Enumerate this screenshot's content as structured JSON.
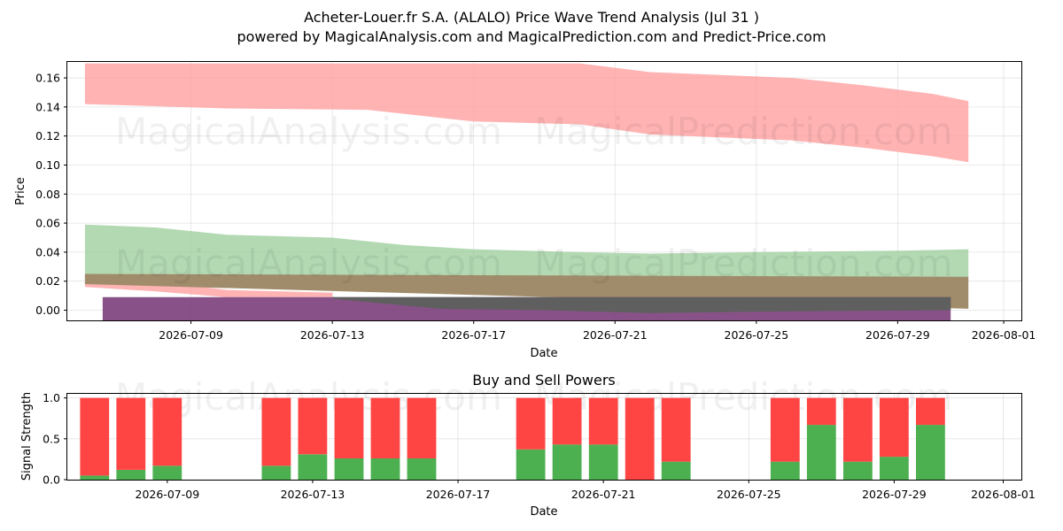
{
  "title": "Acheter-Louer.fr S.A. (ALALO) Price Wave Trend Analysis (Jul 31 )",
  "subtitle": "powered by MagicalAnalysis.com and MagicalPrediction.com and Predict-Price.com",
  "watermarks": [
    "MagicalAnalysis.com",
    "MagicalPrediction.com"
  ],
  "colors": {
    "red_band": "#ff9999",
    "green_band": "#99cc99",
    "brown_band": "#a08c6a",
    "purple_band": "#7b3f7b",
    "buy": "#4caf50",
    "sell": "#ff4444"
  },
  "chart_data": [
    {
      "type": "area",
      "xlabel": "Date",
      "ylabel": "Price",
      "xlim": [
        "2026-07-05T12:00",
        "2026-08-01T12:00"
      ],
      "ylim": [
        -0.007,
        0.171
      ],
      "grid": true,
      "x_ticks": [
        "2026-07-09",
        "2026-07-13",
        "2026-07-17",
        "2026-07-21",
        "2026-07-25",
        "2026-07-29",
        "2026-08-01"
      ],
      "y_ticks": [
        "0.00",
        "0.02",
        "0.04",
        "0.06",
        "0.08",
        "0.10",
        "0.12",
        "0.14",
        "0.16"
      ],
      "series": [
        {
          "key": "red_upper",
          "color": "red_band",
          "opacity": 0.75,
          "x": [
            "2026-07-06",
            "2026-07-10",
            "2026-07-14",
            "2026-07-17",
            "2026-07-20",
            "2026-07-22",
            "2026-07-26",
            "2026-07-28",
            "2026-07-30",
            "2026-07-31"
          ],
          "upper": [
            0.17,
            0.17,
            0.17,
            0.17,
            0.17,
            0.164,
            0.16,
            0.155,
            0.149,
            0.144
          ],
          "lower": [
            0.142,
            0.139,
            0.138,
            0.13,
            0.128,
            0.121,
            0.117,
            0.112,
            0.106,
            0.102
          ]
        },
        {
          "key": "red_lower",
          "color": "red_band",
          "opacity": 0.75,
          "x": [
            "2026-07-06",
            "2026-07-08",
            "2026-07-10",
            "2026-07-13"
          ],
          "upper": [
            0.022,
            0.02,
            0.014,
            0.012
          ],
          "lower": [
            0.016,
            0.013,
            0.009,
            0.009
          ]
        },
        {
          "key": "green",
          "color": "green_band",
          "opacity": 0.75,
          "x": [
            "2026-07-06",
            "2026-07-08",
            "2026-07-10",
            "2026-07-13",
            "2026-07-15",
            "2026-07-17",
            "2026-07-20",
            "2026-07-22",
            "2026-07-25",
            "2026-07-29",
            "2026-07-31"
          ],
          "upper": [
            0.059,
            0.057,
            0.052,
            0.05,
            0.045,
            0.042,
            0.04,
            0.039,
            0.04,
            0.041,
            0.042
          ],
          "lower": [
            0.022,
            0.022,
            0.022,
            0.022,
            0.022,
            0.022,
            0.022,
            0.022,
            0.022,
            0.022,
            0.022
          ]
        },
        {
          "key": "brown",
          "color": "brown_band",
          "opacity": 1,
          "x": [
            "2026-07-06",
            "2026-07-31"
          ],
          "upper": [
            0.025,
            0.023
          ],
          "lower": [
            0.018,
            0.001
          ]
        },
        {
          "key": "purple",
          "color": "purple_band",
          "opacity": 0.9,
          "x": [
            "2026-07-06T12:00",
            "2026-07-10",
            "2026-07-13",
            "2026-07-16",
            "2026-07-19",
            "2026-07-22",
            "2026-07-25",
            "2026-07-28",
            "2026-07-30T12:00"
          ],
          "upper": [
            0.009,
            0.009,
            0.009,
            0.009,
            0.009,
            0.009,
            0.009,
            0.009,
            0.009
          ],
          "lower": [
            -0.007,
            -0.007,
            -0.007,
            -0.007,
            -0.007,
            -0.007,
            -0.007,
            -0.007,
            -0.007
          ]
        },
        {
          "key": "dark",
          "color": "#5f5f5f",
          "opacity": 1,
          "x": [
            "2026-07-13",
            "2026-07-16",
            "2026-07-19",
            "2026-07-22",
            "2026-07-25",
            "2026-07-30T12:00"
          ],
          "upper": [
            0.009,
            0.009,
            0.009,
            0.009,
            0.009,
            0.009
          ],
          "lower": [
            0.008,
            0.001,
            0.0,
            -0.002,
            -0.001,
            0.0
          ]
        }
      ]
    },
    {
      "type": "bar",
      "title": "Buy and Sell Powers",
      "xlabel": "Date",
      "ylabel": "Signal Strength",
      "xlim": [
        "2026-07-06T06:00",
        "2026-08-01T12:00"
      ],
      "ylim": [
        0,
        1.05
      ],
      "grid": true,
      "x_ticks": [
        "2026-07-09",
        "2026-07-13",
        "2026-07-17",
        "2026-07-21",
        "2026-07-25",
        "2026-07-29",
        "2026-08-01"
      ],
      "y_ticks": [
        "0.0",
        "0.5",
        "1.0"
      ],
      "dates": [
        "2026-07-07",
        "2026-07-08",
        "2026-07-09",
        "2026-07-12",
        "2026-07-13",
        "2026-07-14",
        "2026-07-15",
        "2026-07-16",
        "2026-07-19",
        "2026-07-20",
        "2026-07-21",
        "2026-07-22",
        "2026-07-23",
        "2026-07-26",
        "2026-07-27",
        "2026-07-28",
        "2026-07-29",
        "2026-07-30"
      ],
      "series": [
        {
          "name": "Buy",
          "color": "buy",
          "values": [
            0.05,
            0.12,
            0.17,
            0.17,
            0.31,
            0.26,
            0.26,
            0.26,
            0.37,
            0.43,
            0.43,
            0.0,
            0.22,
            0.22,
            0.67,
            0.22,
            0.28,
            0.67
          ]
        },
        {
          "name": "Sell",
          "color": "sell",
          "values": [
            0.95,
            0.88,
            0.83,
            0.83,
            0.69,
            0.74,
            0.74,
            0.74,
            0.63,
            0.57,
            0.57,
            1.0,
            0.78,
            0.78,
            0.33,
            0.78,
            0.72,
            0.33
          ]
        }
      ]
    }
  ]
}
